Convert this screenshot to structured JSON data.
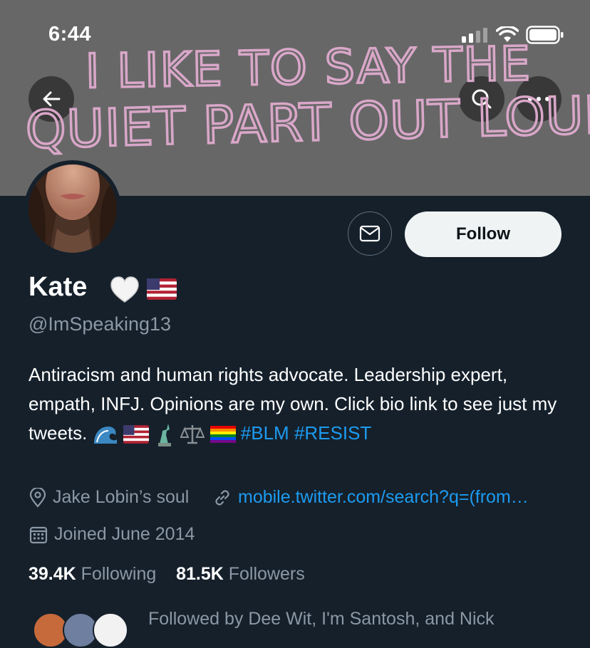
{
  "status_bar": {
    "time": "6:44"
  },
  "banner": {
    "line1": "I LIKE TO SAY THE",
    "line2": "QUIET PART OUT LOUD"
  },
  "profile": {
    "name": "Kate",
    "handle": "@ImSpeaking13",
    "bio_text": "Antiracism and human rights advocate. Leadership expert, empath, INFJ. Opinions are my own. Click bio link to see just my tweets.",
    "hashtags": [
      "#BLM",
      "#RESIST"
    ],
    "location": "Jake Lobin’s soul",
    "website": "mobile.twitter.com/search?q=(from…",
    "joined": "Joined June 2014",
    "following_count": "39.4K",
    "following_label": "Following",
    "followers_count": "81.5K",
    "followers_label": "Followers",
    "followed_by": "Followed by Dee Wit, I'm Santosh, and Nick"
  },
  "actions": {
    "follow_label": "Follow"
  },
  "icons": [
    "back-arrow-icon",
    "search-icon",
    "more-icon",
    "mail-icon",
    "location-icon",
    "link-icon",
    "calendar-icon",
    "white-heart-emoji",
    "us-flag-emoji",
    "wave-emoji",
    "statue-of-liberty-emoji",
    "scales-emoji",
    "rainbow-flag-emoji"
  ],
  "colors": {
    "accent": "#1d9bf0",
    "background": "#15202b",
    "banner": "#676767",
    "banner_text": "#d9a7c9"
  }
}
